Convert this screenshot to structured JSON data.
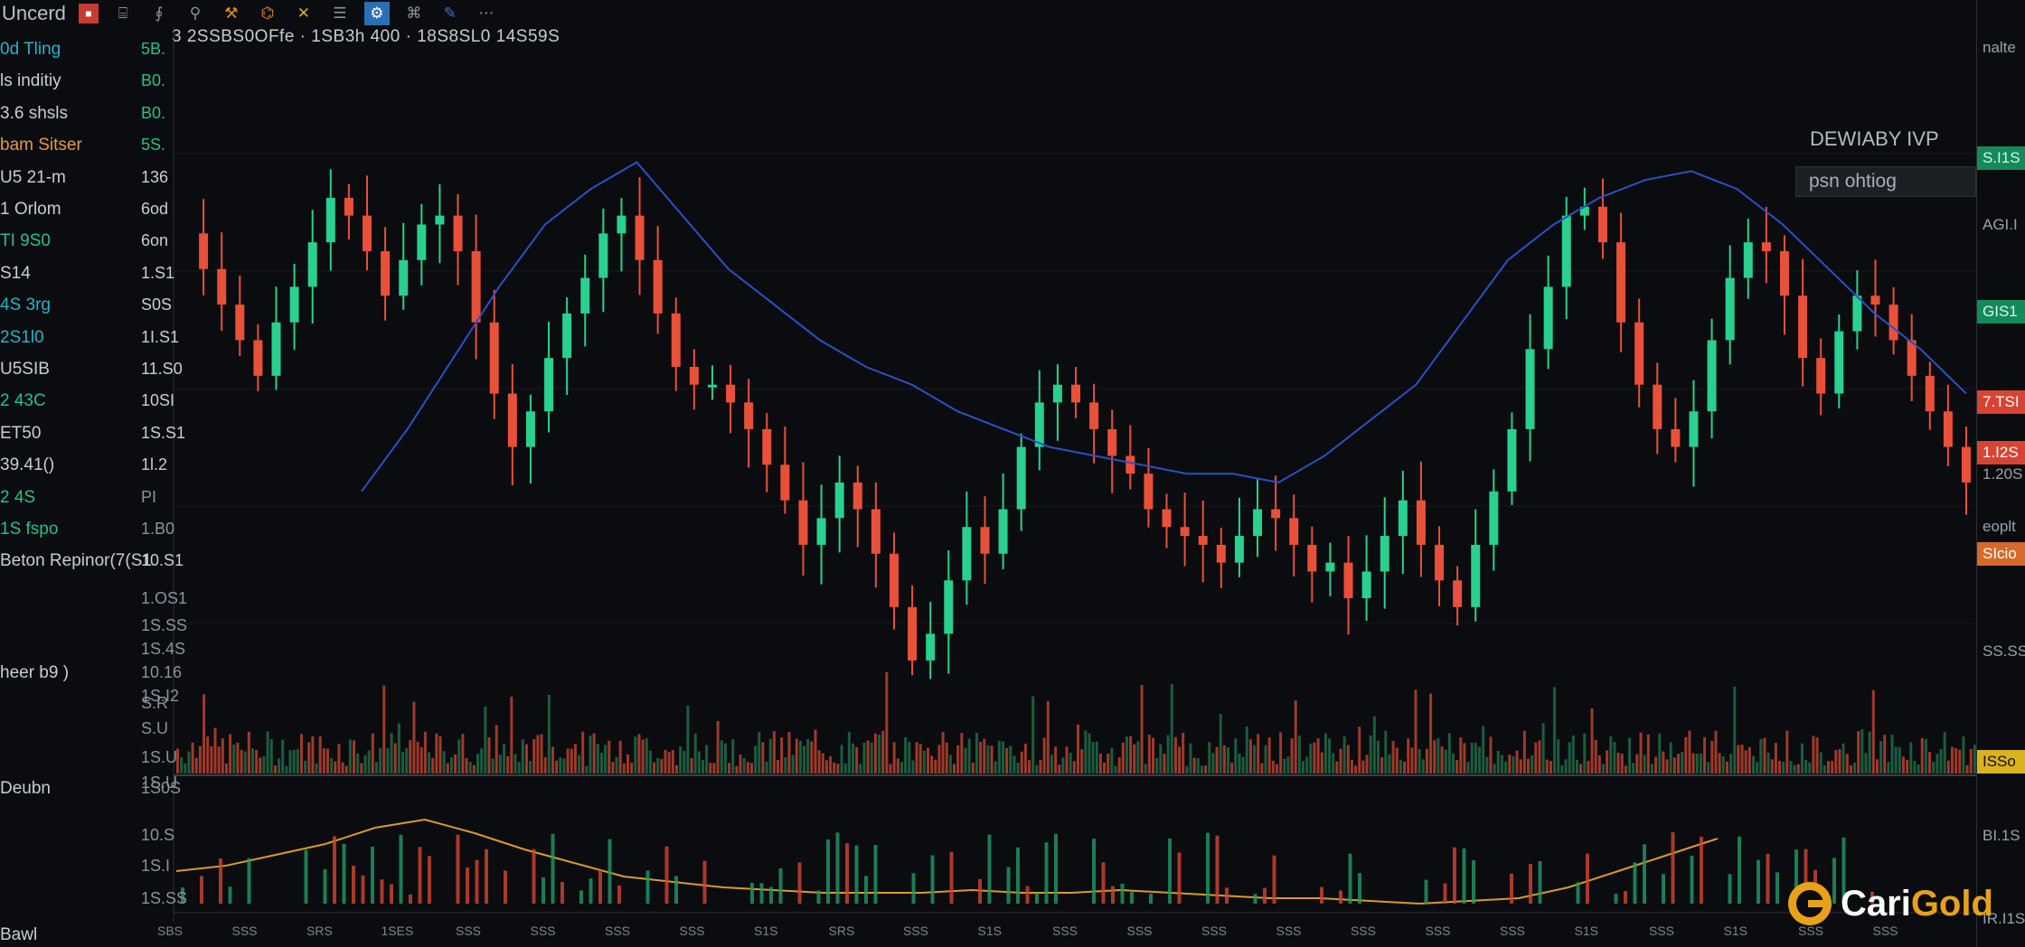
{
  "toolbar": {
    "symbol": "Uncerd",
    "ohlc_readout": "3 2SSBS0OFfe · 1SB3h 400 · 18S8SL0 14S59S"
  },
  "left_panel": {
    "rows": [
      {
        "label": "0d Tling",
        "value": "5B."
      },
      {
        "label": "ls inditiy",
        "value": "B0."
      },
      {
        "label": "3.6 shsls",
        "value": "B0."
      },
      {
        "label": "bam Sitser",
        "value": "5S."
      },
      {
        "label": "U5 21-m",
        "value": "136"
      },
      {
        "label": "1 Orlom",
        "value": "6od"
      },
      {
        "label": "TI 9S0",
        "value": "6on"
      },
      {
        "label": "S14",
        "value": "1.S1"
      },
      {
        "label": "4S 3rg",
        "value": "S0S"
      },
      {
        "label": "2S1l0",
        "value": "1I.S1"
      },
      {
        "label": "U5SIB",
        "value": "11.S0"
      },
      {
        "label": "2 43C",
        "value": "10SI"
      },
      {
        "label": "ET50",
        "value": "1S.S1"
      },
      {
        "label": "39.41()",
        "value": "1l.2"
      },
      {
        "label": "2 4S",
        "value": "PI"
      },
      {
        "label": "1S fspo",
        "value": "1.B0"
      },
      {
        "label": "Beton Repinor(7(S1",
        "value": "10.S1"
      }
    ],
    "lower_values": [
      "1.OS1",
      "1S.SS",
      "1S.4S",
      "10.16",
      "1S.I2"
    ],
    "volume_label": "heer b9 )",
    "volume_values": [
      "S.R",
      "S.U",
      "1S.U",
      "1S.U"
    ],
    "osc_label": "Deubn",
    "osc_values": [
      "1S0S",
      "10.S",
      "1S.I",
      "1S.SS"
    ],
    "bottom_left": "Bawl"
  },
  "right_axis": {
    "tags": [
      {
        "text": "nalte",
        "style": "plain"
      },
      {
        "text": "S.I1S",
        "style": "green"
      },
      {
        "text": "AGI.I",
        "style": "plain"
      },
      {
        "text": "GIS1",
        "style": "green"
      },
      {
        "text": "7.TSI",
        "style": "red"
      },
      {
        "text": "1.I2S",
        "style": "red"
      },
      {
        "text": "1.20S",
        "style": "plain"
      },
      {
        "text": "eoplt",
        "style": "plain"
      },
      {
        "text": "SIcio",
        "style": "orange"
      },
      {
        "text": "SS.SS",
        "style": "plain"
      },
      {
        "text": "ISSo",
        "style": "yellow"
      },
      {
        "text": "BI.1S",
        "style": "plain"
      },
      {
        "text": "IR.I1S",
        "style": "plain"
      }
    ]
  },
  "indicator_widget": {
    "title": "DEWIABY IVP",
    "box": "psn ohtiog"
  },
  "bottom_axis": {
    "ticks": [
      "SBS",
      "SSS",
      "SRS",
      "1SES",
      "SSS",
      "SSS",
      "SSS",
      "SSS",
      "S1S",
      "SRS",
      "SSS",
      "S1S",
      "SSS",
      "SSS",
      "SSS",
      "SSS",
      "SSS",
      "SSS",
      "SSS",
      "S1S",
      "SSS",
      "S1S",
      "SSS",
      "SSS"
    ]
  },
  "logo": {
    "part1": "Cari",
    "part2": "Gold"
  },
  "colors": {
    "up": "#29d08e",
    "down": "#e8503a",
    "ma": "#2b50c7",
    "osc_line": "#d89a2a",
    "background": "#0b0c0f"
  },
  "chart_data": {
    "type": "candlestick",
    "series": [
      {
        "name": "price",
        "values": [
          1.34,
          1.3,
          1.26,
          1.22,
          1.18,
          1.24,
          1.28,
          1.33,
          1.38,
          1.36,
          1.32,
          1.27,
          1.31,
          1.35,
          1.36,
          1.32,
          1.24,
          1.16,
          1.1,
          1.14,
          1.2,
          1.25,
          1.29,
          1.34,
          1.36,
          1.31,
          1.25,
          1.19,
          1.17,
          1.17,
          1.15,
          1.12,
          1.08,
          1.04,
          0.99,
          1.02,
          1.06,
          1.03,
          0.98,
          0.92,
          0.86,
          0.89,
          0.95,
          1.01,
          0.98,
          1.03,
          1.1,
          1.15,
          1.17,
          1.15,
          1.12,
          1.09,
          1.07,
          1.03,
          1.01,
          1.0,
          0.99,
          0.97,
          1.0,
          1.03,
          1.02,
          0.99,
          0.96,
          0.97,
          0.93,
          0.96,
          1.0,
          1.04,
          0.99,
          0.95,
          0.92,
          0.99,
          1.05,
          1.12,
          1.21,
          1.28,
          1.36,
          1.37,
          1.33,
          1.24,
          1.17,
          1.12,
          1.1,
          1.14,
          1.22,
          1.29,
          1.33,
          1.32,
          1.27,
          1.2,
          1.16,
          1.23,
          1.27,
          1.26,
          1.22,
          1.18,
          1.14,
          1.1,
          1.06
        ]
      },
      {
        "name": "ma",
        "values": [
          1.05,
          1.12,
          1.2,
          1.28,
          1.35,
          1.39,
          1.42,
          1.36,
          1.3,
          1.26,
          1.22,
          1.19,
          1.17,
          1.14,
          1.12,
          1.1,
          1.09,
          1.08,
          1.07,
          1.07,
          1.06,
          1.09,
          1.13,
          1.17,
          1.24,
          1.31,
          1.35,
          1.38,
          1.4,
          1.41,
          1.39,
          1.35,
          1.3,
          1.25,
          1.21,
          1.16
        ]
      },
      {
        "name": "oscillator",
        "values": [
          12,
          14,
          18,
          22,
          28,
          31,
          26,
          20,
          15,
          10,
          8,
          6,
          5,
          4,
          4,
          4,
          5,
          4,
          4,
          5,
          4,
          3,
          2,
          2,
          1,
          0,
          1,
          2,
          6,
          12,
          18,
          24
        ]
      }
    ],
    "title": "",
    "xlabel": "",
    "ylabel": ""
  }
}
